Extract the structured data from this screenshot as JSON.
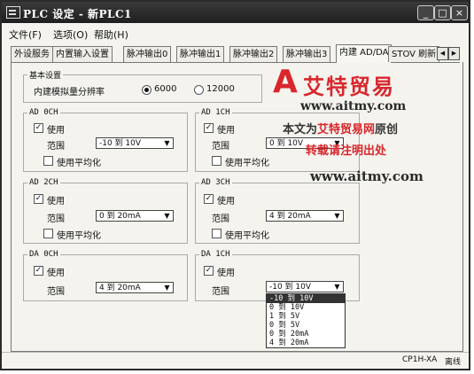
{
  "window": {
    "title": "PLC 设定 - 新PLC1"
  },
  "menu": {
    "file": "文件(F)",
    "options": "选项(O)",
    "help": "帮助(H)"
  },
  "tabs": [
    "外设服务",
    "内置输入设置",
    "脉冲输出0",
    "脉冲输出1",
    "脉冲输出2",
    "脉冲输出3",
    "内建 AD/DA",
    "STOV 刷新"
  ],
  "basic": {
    "legend": "基本设置",
    "resolution_label": "内建模拟量分辨率",
    "opt1": "6000",
    "opt2": "12000"
  },
  "common": {
    "use": "使用",
    "range": "范围",
    "average": "使用平均化"
  },
  "ad0": {
    "legend": "AD 0CH",
    "range": "-10 到 10V"
  },
  "ad1": {
    "legend": "AD 1CH",
    "range": "0 到 10V"
  },
  "ad2": {
    "legend": "AD 2CH",
    "range": "0 到 20mA"
  },
  "ad3": {
    "legend": "AD 3CH",
    "range": "4 到 20mA"
  },
  "da0": {
    "legend": "DA 0CH",
    "range": "4 到 20mA"
  },
  "da1": {
    "legend": "DA 1CH",
    "range": "-10 到 10V"
  },
  "dropdown": [
    "-10 到 10V",
    "0 到 10V",
    "1 到 5V",
    "0 到 5V",
    "0 到 20mA",
    "4 到 20mA"
  ],
  "status": {
    "model": "CP1H-XA",
    "mode": "离线"
  },
  "watermark": {
    "logo": "A",
    "brand": "艾特贸易",
    "url": "www.aitmy.com",
    "line1_a": "本文为",
    "line1_b": "艾特贸易网",
    "line1_c": "原创",
    "line2": "转载请注明出处",
    "url2": "www.aitmy.com"
  },
  "icons": [
    "app-icon",
    "minimize-icon",
    "maximize-icon",
    "close-icon",
    "checkbox-checked-icon",
    "dropdown-arrow-icon",
    "tab-scroll-left-icon",
    "tab-scroll-right-icon"
  ]
}
